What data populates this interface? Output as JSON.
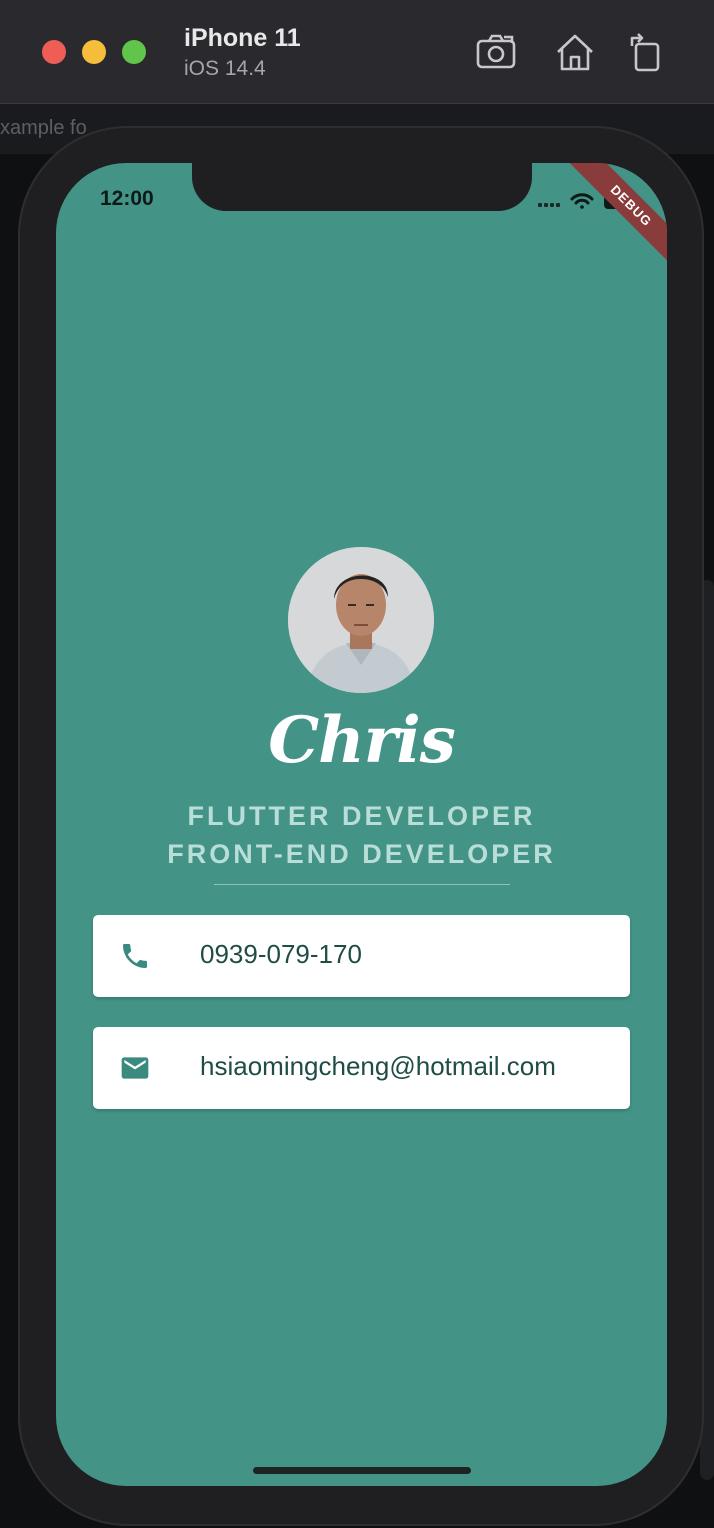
{
  "simulator": {
    "device_name": "iPhone 11",
    "os_version": "iOS 14.4",
    "toolbar_icons": [
      "screenshot-icon",
      "home-icon",
      "rotate-icon"
    ]
  },
  "background_editor": {
    "visible_text": "xample fo"
  },
  "status_bar": {
    "time": "12:00",
    "debug_label": "DEBUG"
  },
  "profile": {
    "name": "Chris",
    "title_line_1": "FLUTTER DEVELOPER",
    "title_line_2": "FRONT-END DEVELOPER"
  },
  "contacts": {
    "phone": {
      "icon": "phone-icon",
      "value": "0939-079-170"
    },
    "email": {
      "icon": "mail-icon",
      "value": "hsiaomingcheng@hotmail.com"
    }
  },
  "colors": {
    "background_teal": "#439387",
    "card_text": "#1f4d46",
    "icon_teal": "#3a8a80",
    "subtitle": "#b9ddd7"
  }
}
